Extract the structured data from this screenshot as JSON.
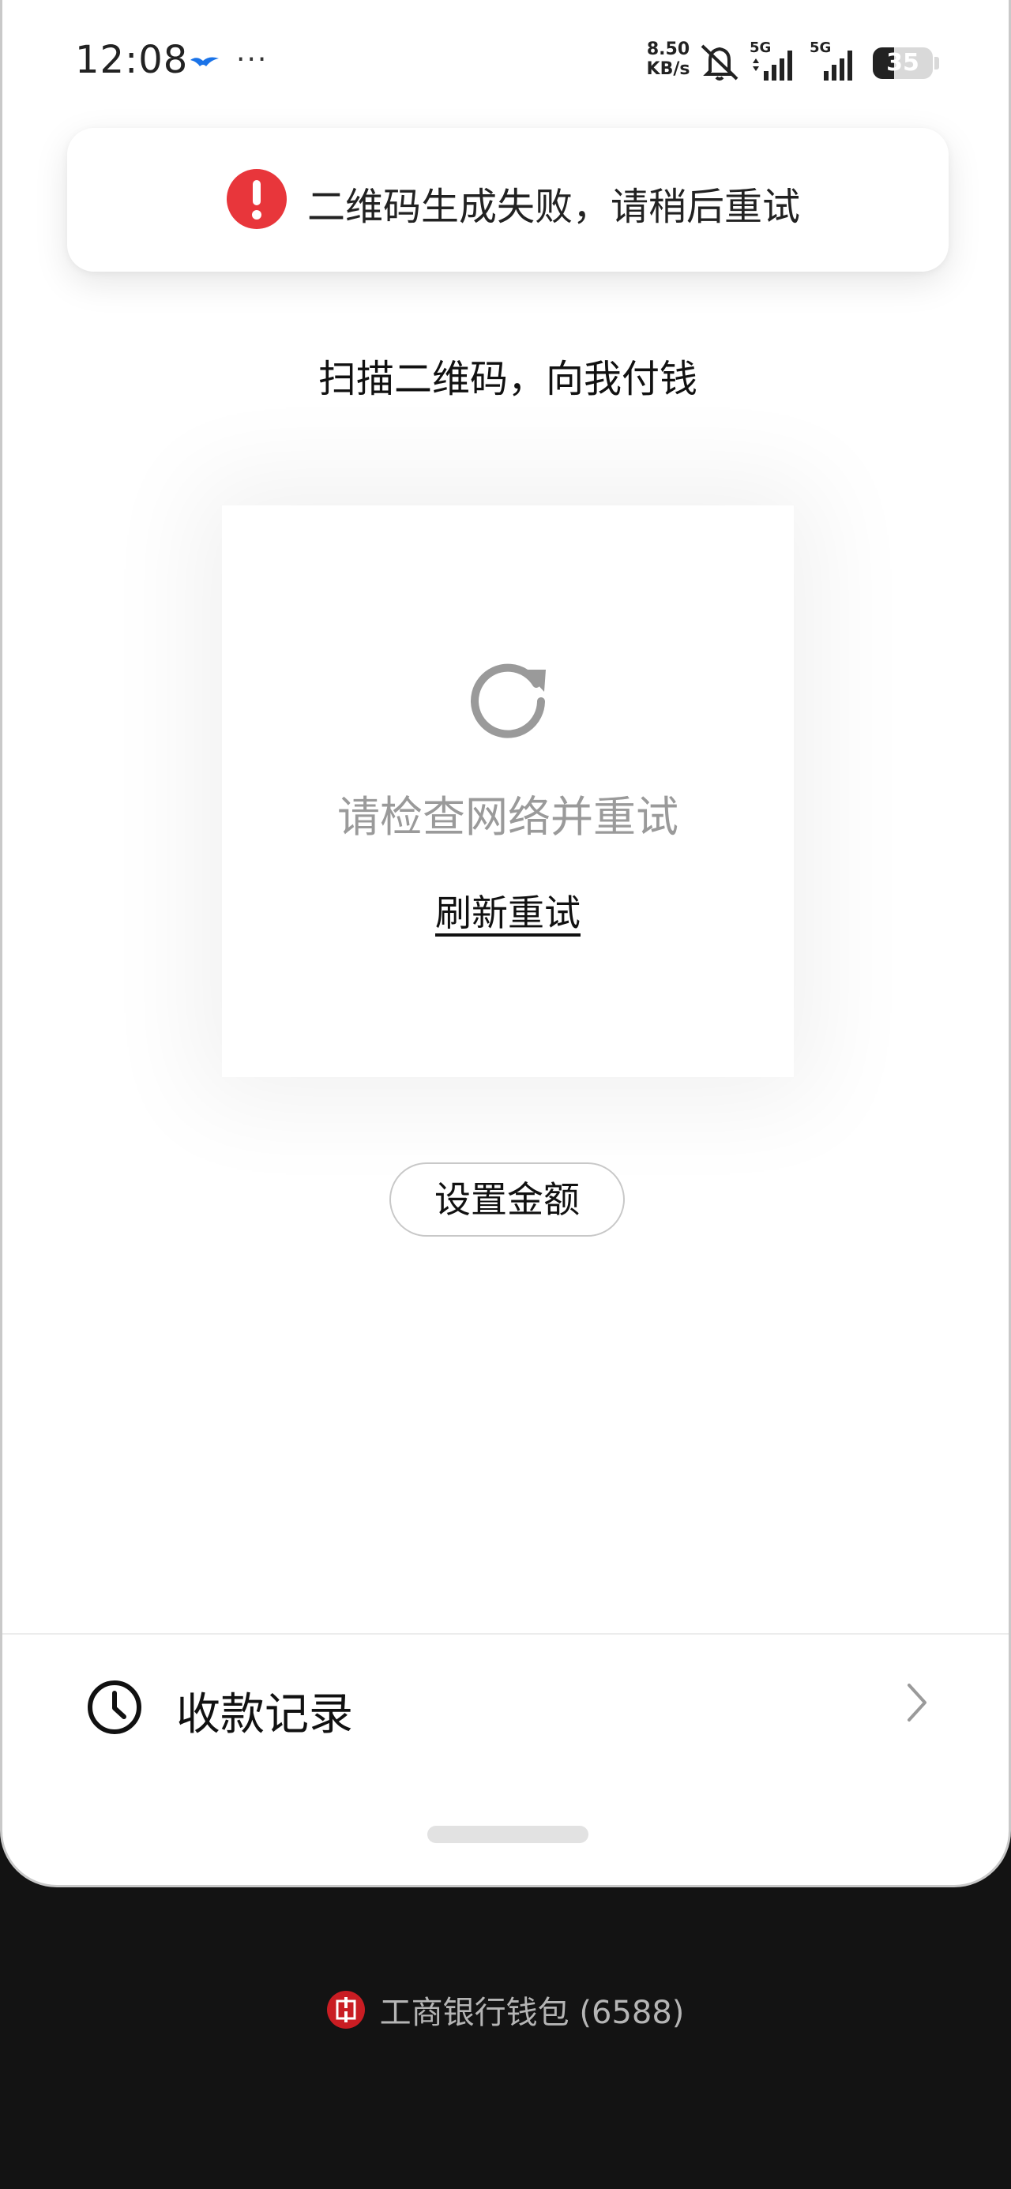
{
  "status_bar": {
    "time": "12:08",
    "net_speed_value": "8.50",
    "net_speed_unit": "KB/s",
    "sim1_label": "5G",
    "sim2_label": "5G",
    "battery": "35",
    "battery_level": 0.35
  },
  "toast": {
    "message": "二维码生成失败，请稍后重试",
    "icon": "error-icon",
    "color": "#e8363b"
  },
  "headline": "扫描二维码，向我付钱",
  "qr_panel": {
    "message": "请检查网络并重试",
    "retry_label": "刷新重试",
    "icon": "refresh-icon"
  },
  "set_amount_label": "设置金额",
  "records": {
    "label": "收款记录",
    "icon": "clock-icon"
  },
  "payment_source": {
    "label": "工商银行钱包 (6588)",
    "brand_color": "#c91d23"
  }
}
